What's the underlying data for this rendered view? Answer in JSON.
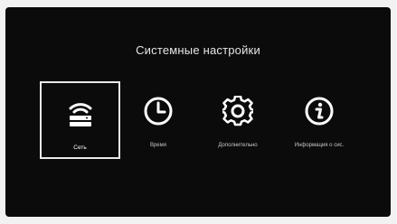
{
  "screen": {
    "title": "Системные настройки"
  },
  "menu": {
    "items": [
      {
        "label": "Сеть",
        "icon": "router-wifi-icon",
        "selected": true
      },
      {
        "label": "Время",
        "icon": "clock-icon",
        "selected": false
      },
      {
        "label": "Дополнительно",
        "icon": "gear-icon",
        "selected": false
      },
      {
        "label": "Информация о сис.",
        "icon": "info-icon",
        "selected": false
      }
    ]
  },
  "colors": {
    "background": "#0b0b0b",
    "text": "#e6e6e6",
    "selection_border": "#e9e9e9"
  }
}
